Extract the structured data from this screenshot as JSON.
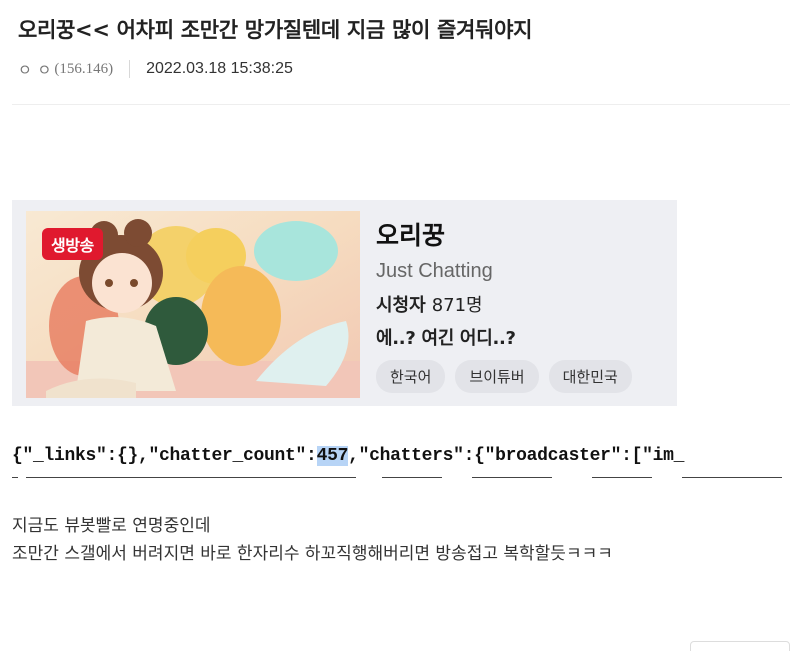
{
  "post": {
    "title": "오리꿍<< 어차피 조만간 망가질텐데 지금 많이 즐겨둬야지",
    "author_nick": "ㅇ ㅇ",
    "author_ip": "(156.146)",
    "date": "2022.03.18 15:38:25"
  },
  "stream_card": {
    "live_badge": "생방송",
    "channel_name": "오리꿍",
    "category": "Just Chatting",
    "viewers_label": "시청자",
    "viewers_count": "871명",
    "stream_title": "에..? 여긴 어디..?",
    "tags": [
      "한국어",
      "브이튜버",
      "대한민국"
    ]
  },
  "json_snippet": {
    "before": "{\"_links\":{},\"chatter_count\":",
    "highlight": "457",
    "after": ",\"chatters\":{\"broadcaster\":[\"im_"
  },
  "body": {
    "lines": [
      "지금도 뷰봇빨로 연명중인데",
      "조만간 스갤에서 버려지면 바로 한자리수 하꼬직행해버리면 방송접고 복학할듯ㅋㅋㅋ"
    ]
  }
}
